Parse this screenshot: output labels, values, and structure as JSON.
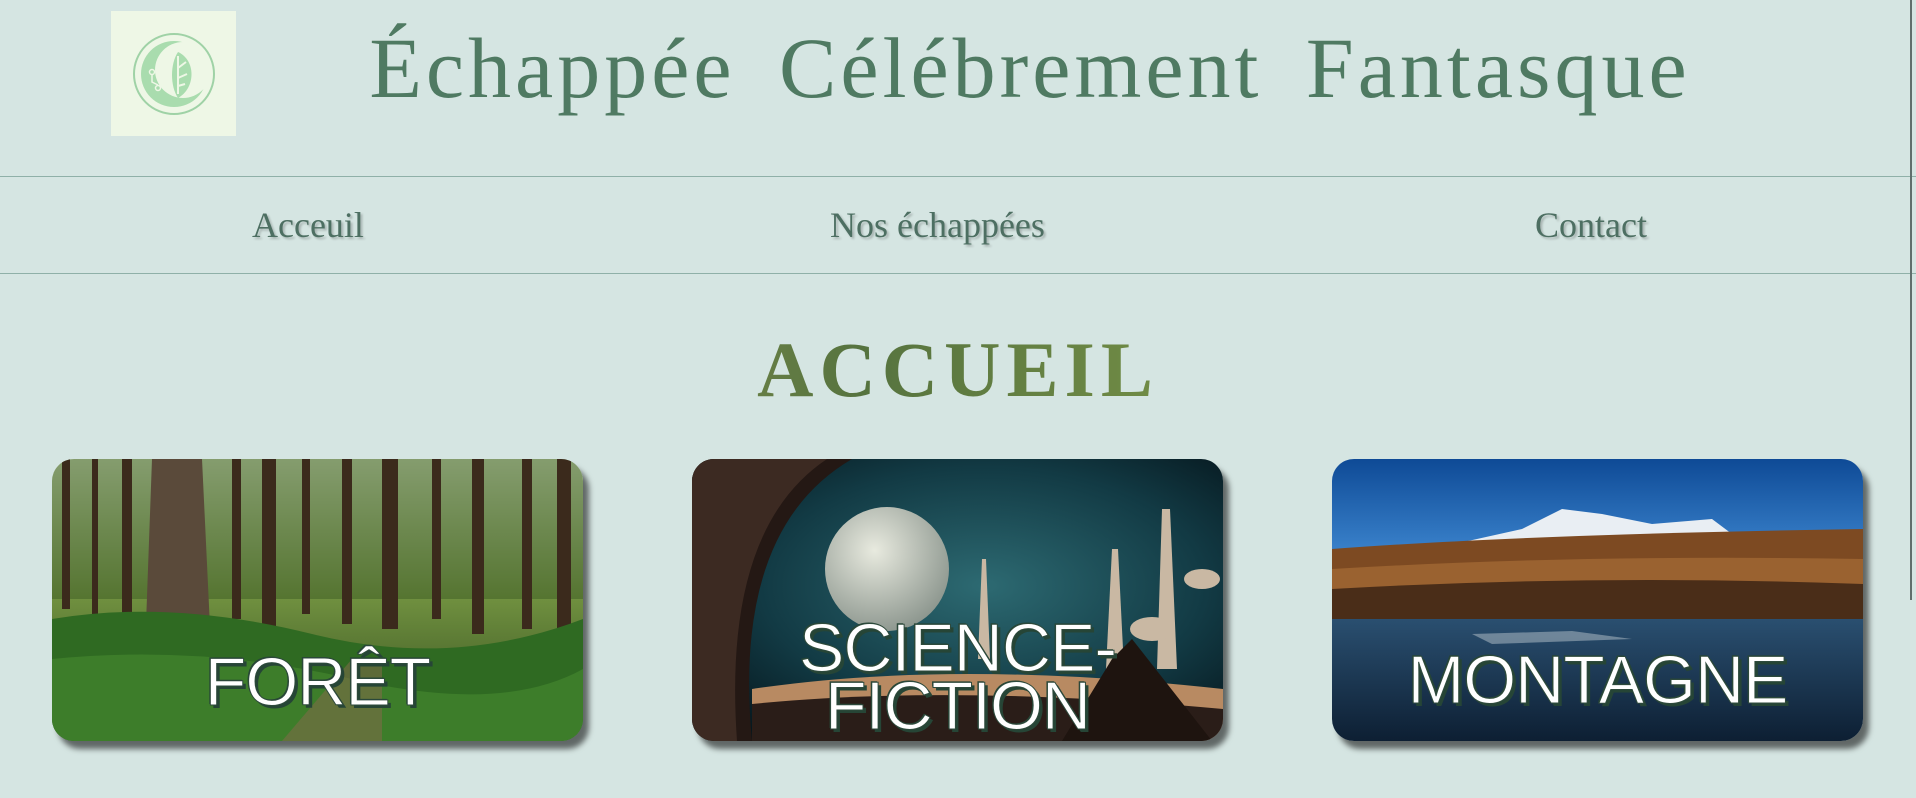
{
  "header": {
    "title": "Échappée Célébrement Fantasque",
    "logo_icon": "moon-leaf-circuit-logo"
  },
  "nav": {
    "items": [
      {
        "label": "Acceuil"
      },
      {
        "label": "Nos échappées"
      },
      {
        "label": "Contact"
      }
    ]
  },
  "main": {
    "heading": "ACCUEIL",
    "cards": [
      {
        "label": "FORÊT",
        "image": "forest-photo"
      },
      {
        "label_line1": "SCIENCE-",
        "label_line2": "FICTION",
        "image": "sci-fi-city-planet"
      },
      {
        "label": "MONTAGNE",
        "image": "mountain-lake-photo"
      }
    ]
  },
  "colors": {
    "background": "#d5e5e2",
    "title": "#4f7a62",
    "nav_text": "#4d6f62",
    "logo_bg": "#eef7e6"
  }
}
